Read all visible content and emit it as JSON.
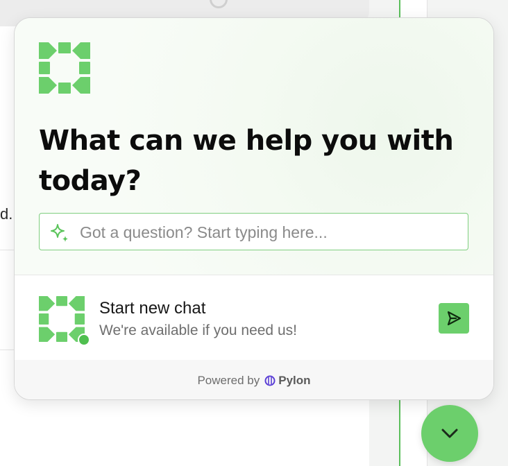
{
  "background": {
    "fragment_text": "d."
  },
  "widget": {
    "title": "What can we help you with today?",
    "search": {
      "placeholder": "Got a question? Start typing here...",
      "value": ""
    },
    "chat": {
      "title": "Start new chat",
      "subtitle": "We're available if you need us!",
      "status": "online"
    },
    "footer": {
      "powered_by": "Powered by",
      "brand": "Pylon"
    }
  },
  "colors": {
    "accent": "#6ccf6c",
    "accent_dark": "#3a9a3a",
    "pylon": "#5b3fd6"
  },
  "icons": {
    "logo": "company-logo-icon",
    "search": "sparkle-icon",
    "send": "send-icon",
    "footer": "pylon-icon",
    "fab": "chevron-down-icon"
  }
}
